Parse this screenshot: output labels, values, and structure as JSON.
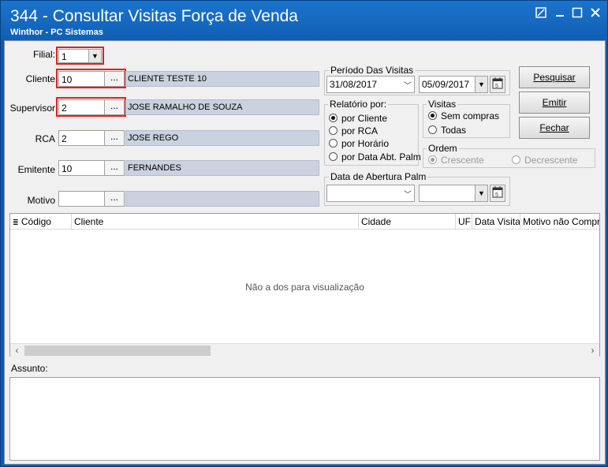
{
  "window": {
    "title": "344 - Consultar Visitas Força de Venda",
    "subtitle": "Winthor - PC Sistemas",
    "controls": [
      "restore-icon",
      "minimize-icon",
      "maximize-icon",
      "close-icon"
    ]
  },
  "filters": {
    "filial": {
      "label": "Filial:",
      "value": "1"
    },
    "cliente": {
      "label": "Cliente",
      "code": "10",
      "button": "...",
      "name": "CLIENTE TESTE 10"
    },
    "supervisor": {
      "label": "Supervisor",
      "code": "2",
      "button": "...",
      "name": "JOSE RAMALHO DE SOUZA"
    },
    "rca": {
      "label": "RCA",
      "code": "2",
      "button": "...",
      "name": "JOSE REGO"
    },
    "emitente": {
      "label": "Emitente",
      "code": "10",
      "button": "...",
      "name": "FERNANDES"
    },
    "motivo": {
      "label": "Motivo",
      "code": "",
      "button": "...",
      "name": ""
    }
  },
  "periodo": {
    "label": "Período Das Visitas",
    "start": "31/08/2017",
    "end": "05/09/2017"
  },
  "relatorio": {
    "label": "Relatório por:",
    "options": [
      "por Cliente",
      "por RCA",
      "por Horário",
      "por Data Abt. Palm"
    ],
    "selected": "por Cliente"
  },
  "visitas": {
    "label": "Visitas",
    "options": [
      "Sem compras",
      "Todas"
    ],
    "selected": "Sem compras"
  },
  "ordem": {
    "label": "Ordem",
    "options": [
      "Crescente",
      "Decrescente"
    ],
    "selected": "Crescente",
    "disabled": true
  },
  "abertura_palm": {
    "label": "Data de Abertura Palm",
    "start": "",
    "end": ""
  },
  "buttons": {
    "pesquisar": "Pesquisar",
    "emitir": "Emitir",
    "fechar": "Fechar"
  },
  "grid": {
    "columns": [
      "Código",
      "Cliente",
      "Cidade",
      "UF",
      "Data Visita",
      "Motivo não Compra"
    ],
    "empty_message": "Não a dos para visualização"
  },
  "assunto": {
    "label": "Assunto:",
    "value": ""
  },
  "colors": {
    "title_bar": "#1c74cc",
    "highlight": "#e02020",
    "readonly_field": "#c9d2de"
  }
}
